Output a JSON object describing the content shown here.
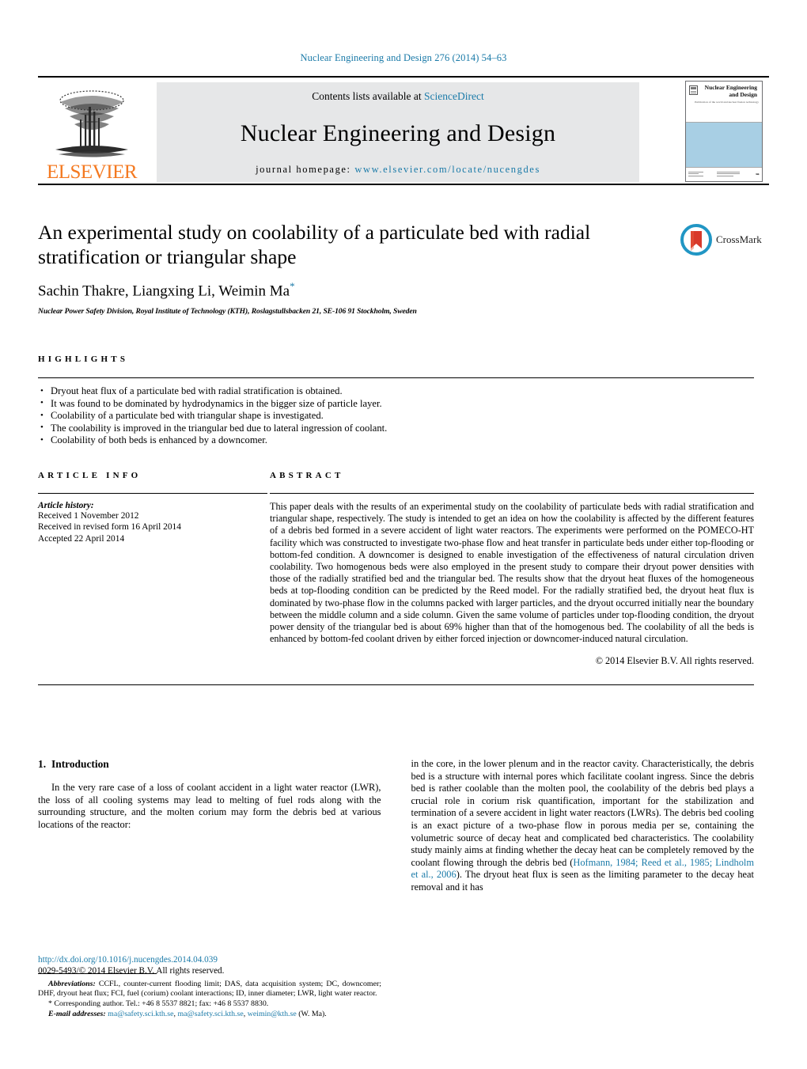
{
  "running_head": "Nuclear Engineering and Design 276 (2014) 54–63",
  "masthead": {
    "contents_prefix": "Contents lists available at ",
    "sciencedirect": "ScienceDirect",
    "journal_title": "Nuclear Engineering and Design",
    "homepage_prefix": "journal homepage: ",
    "homepage_url": "www.elsevier.com/locate/nucengdes",
    "publisher_wordmark": "ELSEVIER",
    "cover": {
      "title": "Nuclear Engineering and Design",
      "subtitle": "Publication of the world and nuclear fission technology"
    }
  },
  "article": {
    "title": "An experimental study on coolability of a particulate bed with radial stratification or triangular shape",
    "authors": "Sachin Thakre, Liangxing Li, Weimin Ma",
    "corresponding_marker": "*",
    "affiliation": "Nuclear Power Safety Division, Royal Institute of Technology (KTH), Roslagstullsbacken 21, SE-106 91 Stockholm, Sweden",
    "crossmark_label": "CrossMark"
  },
  "highlights": {
    "heading": "HIGHLIGHTS",
    "items": [
      "Dryout heat flux of a particulate bed with radial stratification is obtained.",
      "It was found to be dominated by hydrodynamics in the bigger size of particle layer.",
      "Coolability of a particulate bed with triangular shape is investigated.",
      "The coolability is improved in the triangular bed due to lateral ingression of coolant.",
      "Coolability of both beds is enhanced by a downcomer."
    ]
  },
  "article_info": {
    "heading": "ARTICLE INFO",
    "history_label": "Article history:",
    "history": [
      "Received 1 November 2012",
      "Received in revised form 16 April 2014",
      "Accepted 22 April 2014"
    ]
  },
  "abstract": {
    "heading": "ABSTRACT",
    "body": "This paper deals with the results of an experimental study on the coolability of particulate beds with radial stratification and triangular shape, respectively. The study is intended to get an idea on how the coolability is affected by the different features of a debris bed formed in a severe accident of light water reactors. The experiments were performed on the POMECO-HT facility which was constructed to investigate two-phase flow and heat transfer in particulate beds under either top-flooding or bottom-fed condition. A downcomer is designed to enable investigation of the effectiveness of natural circulation driven coolability. Two homogenous beds were also employed in the present study to compare their dryout power densities with those of the radially stratified bed and the triangular bed. The results show that the dryout heat fluxes of the homogeneous beds at top-flooding condition can be predicted by the Reed model. For the radially stratified bed, the dryout heat flux is dominated by two-phase flow in the columns packed with larger particles, and the dryout occurred initially near the boundary between the middle column and a side column. Given the same volume of particles under top-flooding condition, the dryout power density of the triangular bed is about 69% higher than that of the homogenous bed. The coolability of all the beds is enhanced by bottom-fed coolant driven by either forced injection or downcomer-induced natural circulation.",
    "copyright": "© 2014 Elsevier B.V. All rights reserved."
  },
  "introduction": {
    "number": "1.",
    "heading": "Introduction",
    "left_paragraph": "In the very rare case of a loss of coolant accident in a light water reactor (LWR), the loss of all cooling systems may lead to melting of fuel rods along with the surrounding structure, and the molten corium may form the debris bed at various locations of the reactor:",
    "right_part1": "in the core, in the lower plenum and in the reactor cavity. Characteristically, the debris bed is a structure with internal pores which facilitate coolant ingress. Since the debris bed is rather coolable than the molten pool, the coolability of the debris bed plays a crucial role in corium risk quantification, important for the stabilization and termination of a severe accident in light water reactors (LWRs). The debris bed cooling is an exact picture of a two-phase flow in porous media per se, containing the volumetric source of decay heat and complicated bed characteristics. The coolability study mainly aims at finding whether the decay heat can be completely removed by the coolant flowing through the debris bed (",
    "right_citation": "Hofmann, 1984; Reed et al., 1985; Lindholm et al., 2006",
    "right_part2": "). The dryout heat flux is seen as the limiting parameter to the decay heat removal and it has"
  },
  "footnotes": {
    "abbreviations_label": "Abbreviations:",
    "abbreviations_text": " CCFL, counter-current flooding limit; DAS, data acquisition system; DC, downcomer; DHF, dryout heat flux; FCI, fuel (corium) coolant interactions; ID, inner diameter; LWR, light water reactor.",
    "corresponding_marker": "*",
    "corresponding_text": " Corresponding author. Tel.: +46 8 5537 8821; fax: +46 8 5537 8830.",
    "email_label": "E-mail addresses:",
    "email1": "ma@safety.sci.kth.se",
    "email2": "ma@safety.sci.kth.se",
    "email3": "weimin@kth.se",
    "email_owner": " (W. Ma).",
    "doi": "http://dx.doi.org/10.1016/j.nucengdes.2014.04.039",
    "issn_line": "0029-5493/© 2014 Elsevier B.V. All rights reserved."
  },
  "colors": {
    "link": "#1a7aa8",
    "elsevier_orange": "#F47920",
    "panel_gray": "#e6e7e8",
    "cover_blue": "#a8cfe4"
  }
}
